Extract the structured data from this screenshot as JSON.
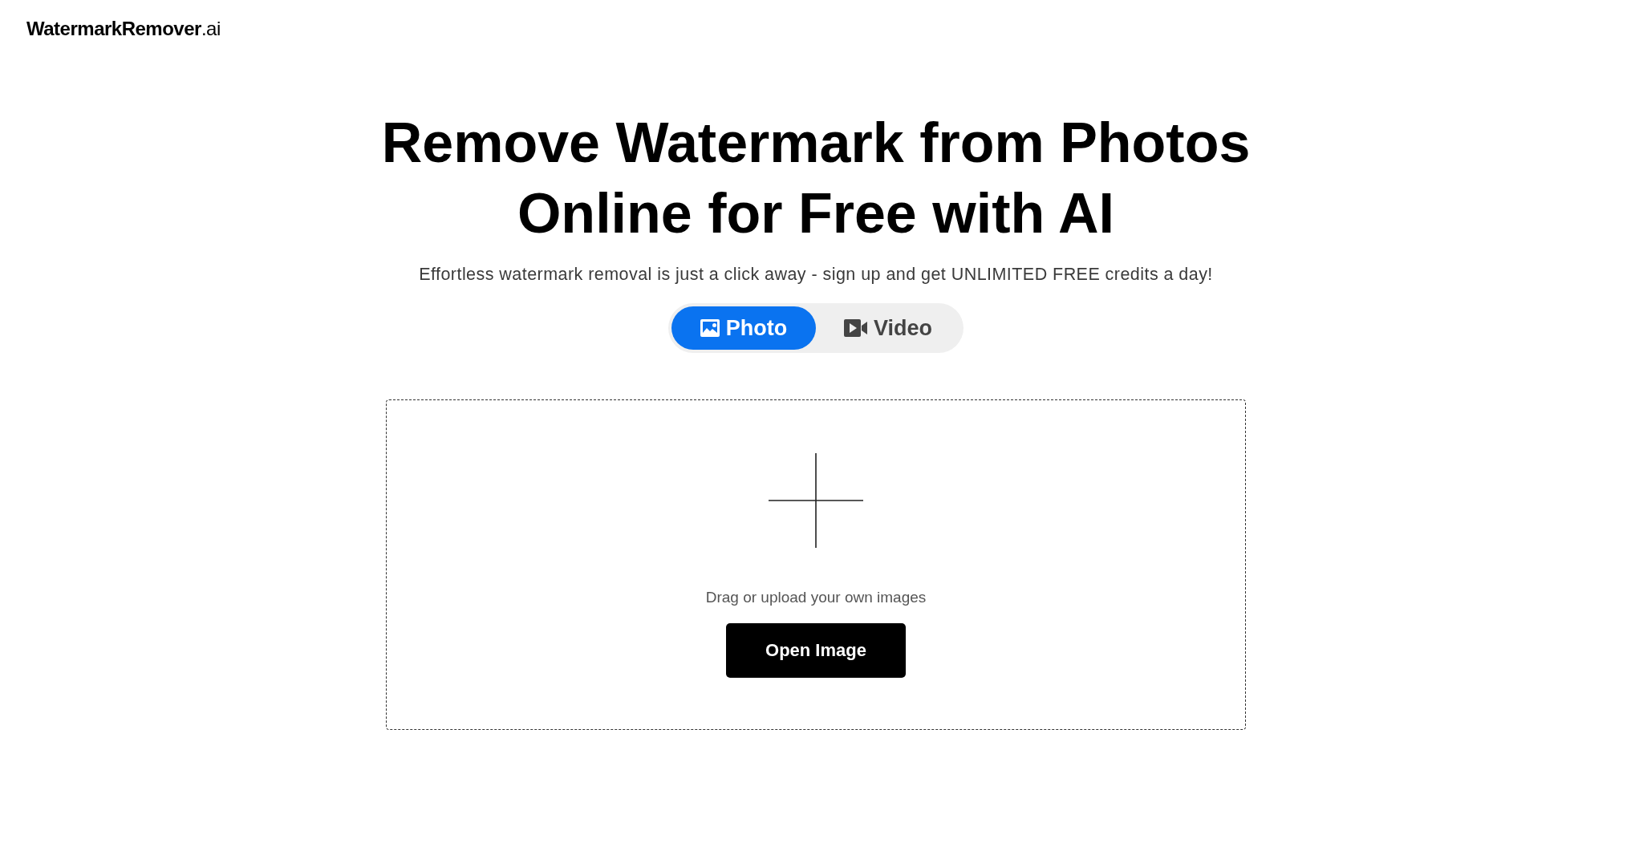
{
  "header": {
    "logo": "**WatermarkRemover**.ai"
  },
  "hero": {
    "title": "Remove Watermark from Photos Online for Free with AI",
    "subtitle": "Effortless watermark removal is just a click away - sign up and get UNLIMITED FREE credits a day!"
  },
  "media_tabs": [
    {
      "kind": "photo",
      "label": "Photo",
      "selected": true
    },
    {
      "kind": "video",
      "label": "Video",
      "selected": false
    }
  ],
  "upload": {
    "hint": "Drag or upload your own images",
    "button": "Open Image"
  }
}
